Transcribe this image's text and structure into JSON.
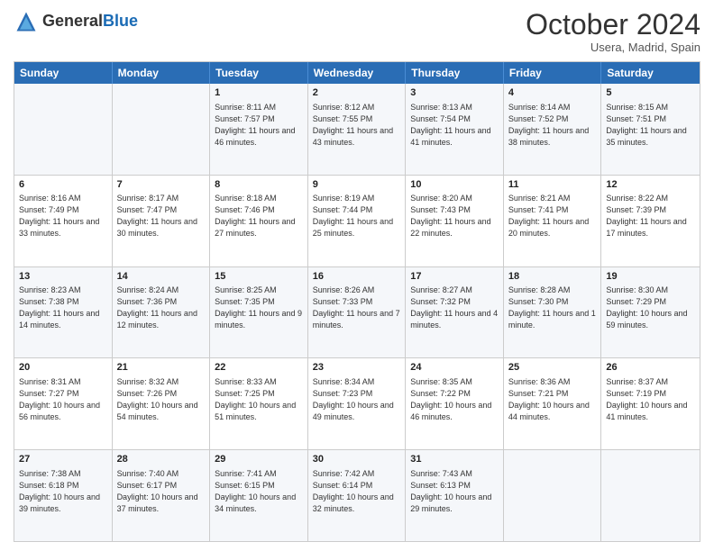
{
  "header": {
    "logo_general": "General",
    "logo_blue": "Blue",
    "month": "October 2024",
    "location": "Usera, Madrid, Spain"
  },
  "days_of_week": [
    "Sunday",
    "Monday",
    "Tuesday",
    "Wednesday",
    "Thursday",
    "Friday",
    "Saturday"
  ],
  "weeks": [
    [
      {
        "day": "",
        "sunrise": "",
        "sunset": "",
        "daylight": ""
      },
      {
        "day": "",
        "sunrise": "",
        "sunset": "",
        "daylight": ""
      },
      {
        "day": "1",
        "sunrise": "Sunrise: 8:11 AM",
        "sunset": "Sunset: 7:57 PM",
        "daylight": "Daylight: 11 hours and 46 minutes."
      },
      {
        "day": "2",
        "sunrise": "Sunrise: 8:12 AM",
        "sunset": "Sunset: 7:55 PM",
        "daylight": "Daylight: 11 hours and 43 minutes."
      },
      {
        "day": "3",
        "sunrise": "Sunrise: 8:13 AM",
        "sunset": "Sunset: 7:54 PM",
        "daylight": "Daylight: 11 hours and 41 minutes."
      },
      {
        "day": "4",
        "sunrise": "Sunrise: 8:14 AM",
        "sunset": "Sunset: 7:52 PM",
        "daylight": "Daylight: 11 hours and 38 minutes."
      },
      {
        "day": "5",
        "sunrise": "Sunrise: 8:15 AM",
        "sunset": "Sunset: 7:51 PM",
        "daylight": "Daylight: 11 hours and 35 minutes."
      }
    ],
    [
      {
        "day": "6",
        "sunrise": "Sunrise: 8:16 AM",
        "sunset": "Sunset: 7:49 PM",
        "daylight": "Daylight: 11 hours and 33 minutes."
      },
      {
        "day": "7",
        "sunrise": "Sunrise: 8:17 AM",
        "sunset": "Sunset: 7:47 PM",
        "daylight": "Daylight: 11 hours and 30 minutes."
      },
      {
        "day": "8",
        "sunrise": "Sunrise: 8:18 AM",
        "sunset": "Sunset: 7:46 PM",
        "daylight": "Daylight: 11 hours and 27 minutes."
      },
      {
        "day": "9",
        "sunrise": "Sunrise: 8:19 AM",
        "sunset": "Sunset: 7:44 PM",
        "daylight": "Daylight: 11 hours and 25 minutes."
      },
      {
        "day": "10",
        "sunrise": "Sunrise: 8:20 AM",
        "sunset": "Sunset: 7:43 PM",
        "daylight": "Daylight: 11 hours and 22 minutes."
      },
      {
        "day": "11",
        "sunrise": "Sunrise: 8:21 AM",
        "sunset": "Sunset: 7:41 PM",
        "daylight": "Daylight: 11 hours and 20 minutes."
      },
      {
        "day": "12",
        "sunrise": "Sunrise: 8:22 AM",
        "sunset": "Sunset: 7:39 PM",
        "daylight": "Daylight: 11 hours and 17 minutes."
      }
    ],
    [
      {
        "day": "13",
        "sunrise": "Sunrise: 8:23 AM",
        "sunset": "Sunset: 7:38 PM",
        "daylight": "Daylight: 11 hours and 14 minutes."
      },
      {
        "day": "14",
        "sunrise": "Sunrise: 8:24 AM",
        "sunset": "Sunset: 7:36 PM",
        "daylight": "Daylight: 11 hours and 12 minutes."
      },
      {
        "day": "15",
        "sunrise": "Sunrise: 8:25 AM",
        "sunset": "Sunset: 7:35 PM",
        "daylight": "Daylight: 11 hours and 9 minutes."
      },
      {
        "day": "16",
        "sunrise": "Sunrise: 8:26 AM",
        "sunset": "Sunset: 7:33 PM",
        "daylight": "Daylight: 11 hours and 7 minutes."
      },
      {
        "day": "17",
        "sunrise": "Sunrise: 8:27 AM",
        "sunset": "Sunset: 7:32 PM",
        "daylight": "Daylight: 11 hours and 4 minutes."
      },
      {
        "day": "18",
        "sunrise": "Sunrise: 8:28 AM",
        "sunset": "Sunset: 7:30 PM",
        "daylight": "Daylight: 11 hours and 1 minute."
      },
      {
        "day": "19",
        "sunrise": "Sunrise: 8:30 AM",
        "sunset": "Sunset: 7:29 PM",
        "daylight": "Daylight: 10 hours and 59 minutes."
      }
    ],
    [
      {
        "day": "20",
        "sunrise": "Sunrise: 8:31 AM",
        "sunset": "Sunset: 7:27 PM",
        "daylight": "Daylight: 10 hours and 56 minutes."
      },
      {
        "day": "21",
        "sunrise": "Sunrise: 8:32 AM",
        "sunset": "Sunset: 7:26 PM",
        "daylight": "Daylight: 10 hours and 54 minutes."
      },
      {
        "day": "22",
        "sunrise": "Sunrise: 8:33 AM",
        "sunset": "Sunset: 7:25 PM",
        "daylight": "Daylight: 10 hours and 51 minutes."
      },
      {
        "day": "23",
        "sunrise": "Sunrise: 8:34 AM",
        "sunset": "Sunset: 7:23 PM",
        "daylight": "Daylight: 10 hours and 49 minutes."
      },
      {
        "day": "24",
        "sunrise": "Sunrise: 8:35 AM",
        "sunset": "Sunset: 7:22 PM",
        "daylight": "Daylight: 10 hours and 46 minutes."
      },
      {
        "day": "25",
        "sunrise": "Sunrise: 8:36 AM",
        "sunset": "Sunset: 7:21 PM",
        "daylight": "Daylight: 10 hours and 44 minutes."
      },
      {
        "day": "26",
        "sunrise": "Sunrise: 8:37 AM",
        "sunset": "Sunset: 7:19 PM",
        "daylight": "Daylight: 10 hours and 41 minutes."
      }
    ],
    [
      {
        "day": "27",
        "sunrise": "Sunrise: 7:38 AM",
        "sunset": "Sunset: 6:18 PM",
        "daylight": "Daylight: 10 hours and 39 minutes."
      },
      {
        "day": "28",
        "sunrise": "Sunrise: 7:40 AM",
        "sunset": "Sunset: 6:17 PM",
        "daylight": "Daylight: 10 hours and 37 minutes."
      },
      {
        "day": "29",
        "sunrise": "Sunrise: 7:41 AM",
        "sunset": "Sunset: 6:15 PM",
        "daylight": "Daylight: 10 hours and 34 minutes."
      },
      {
        "day": "30",
        "sunrise": "Sunrise: 7:42 AM",
        "sunset": "Sunset: 6:14 PM",
        "daylight": "Daylight: 10 hours and 32 minutes."
      },
      {
        "day": "31",
        "sunrise": "Sunrise: 7:43 AM",
        "sunset": "Sunset: 6:13 PM",
        "daylight": "Daylight: 10 hours and 29 minutes."
      },
      {
        "day": "",
        "sunrise": "",
        "sunset": "",
        "daylight": ""
      },
      {
        "day": "",
        "sunrise": "",
        "sunset": "",
        "daylight": ""
      }
    ]
  ]
}
